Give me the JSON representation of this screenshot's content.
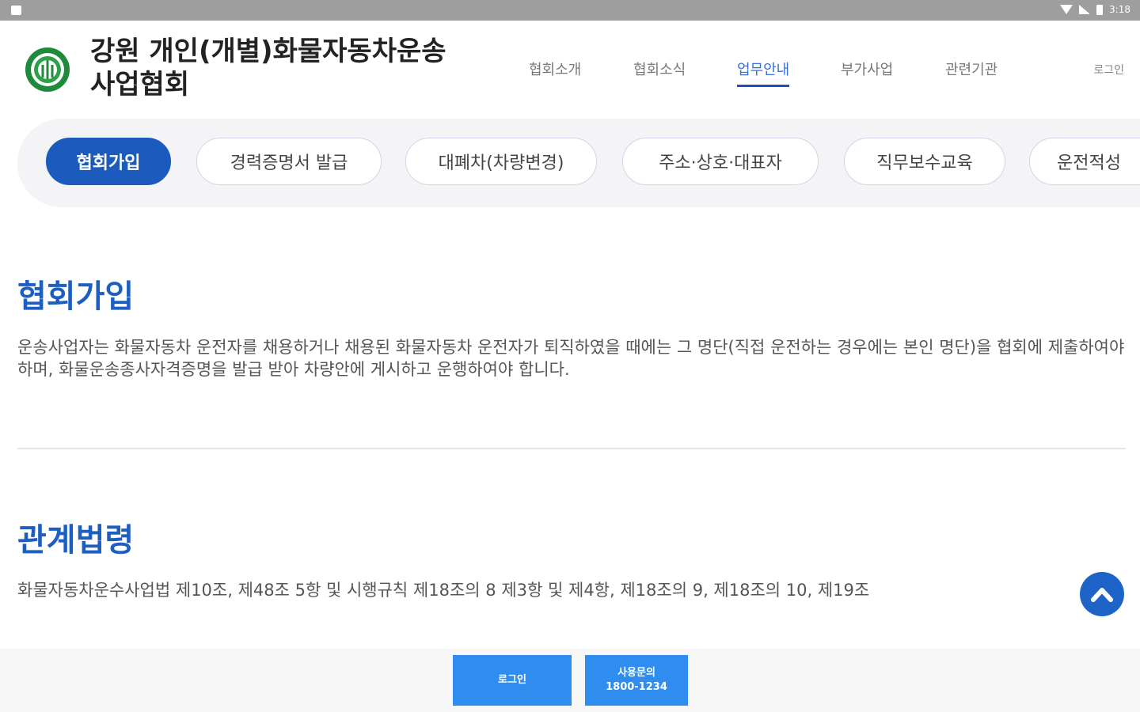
{
  "status_bar": {
    "time": "3:18"
  },
  "header": {
    "title_line1": "강원 개인(개별)화물자동차운송",
    "title_line2": "사업협회",
    "nav": [
      "협회소개",
      "협회소식",
      "업무안내",
      "부가사업",
      "관련기관"
    ],
    "active_nav": "업무안내",
    "login": "로그인"
  },
  "tabs": [
    "협회가입",
    "경력증명서 발급",
    "대폐차(차량변경)",
    "주소·상호·대표자",
    "직무보수교육",
    "운전적성"
  ],
  "active_tab": "협회가입",
  "sections": [
    {
      "title": "협회가입",
      "text": "운송사업자는 화물자동차 운전자를 채용하거나 채용된 화물자동차 운전자가 퇴직하였을 때에는 그 명단(직접 운전하는 경우에는 본인 명단)을 협회에 제출하여야 하며, 화물운송종사자격증명을 발급 받아 차량안에 게시하고 운행하여야 합니다."
    },
    {
      "title": "관계법령",
      "text": "화물자동차운수사업법 제10조, 제48조 5항 및 시행규칙 제18조의 8 제3항 및 제4항, 제18조의 9, 제18조의 10, 제19조"
    }
  ],
  "footer": {
    "login_button": "로그인",
    "inquiry_label": "사용문의",
    "inquiry_phone": "1800-1234"
  },
  "colors": {
    "primary": "#1b5bbd",
    "accent_blue": "#1f5ec1",
    "footer_button": "#2f8df0"
  }
}
